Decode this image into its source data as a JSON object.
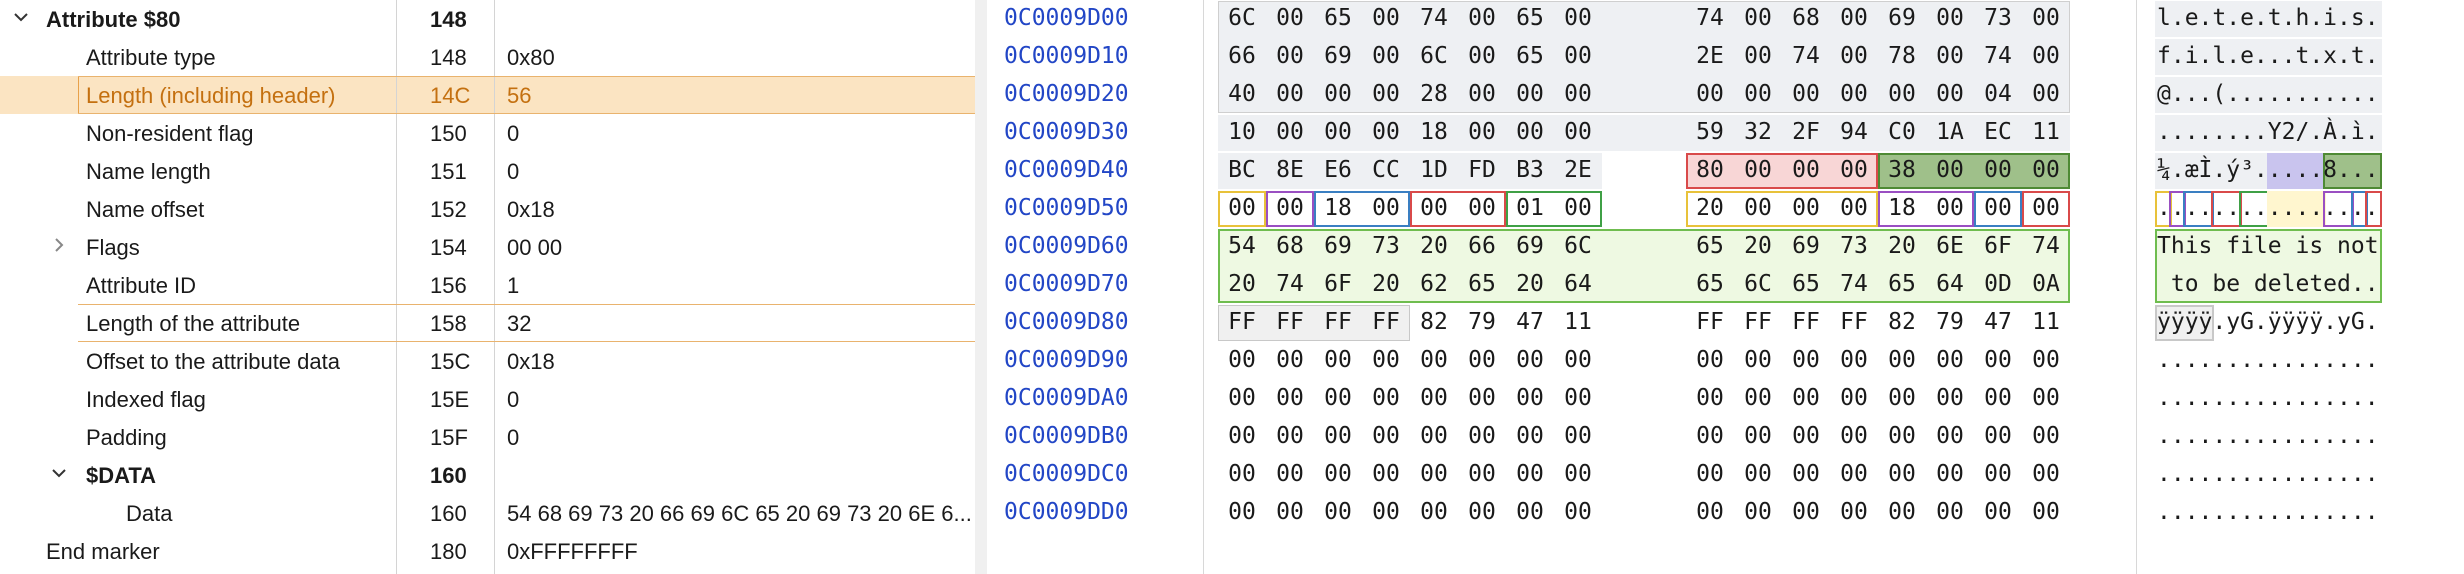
{
  "tree": {
    "rows": [
      {
        "name": "Attribute $80",
        "offset": "148",
        "value": "",
        "level": 0,
        "toggle": "expanded",
        "bold": true
      },
      {
        "name": "Attribute type",
        "offset": "148",
        "value": "0x80",
        "level": 1
      },
      {
        "name": "Length (including header)",
        "offset": "14C",
        "value": "56",
        "level": 1,
        "selected": true
      },
      {
        "name": "Non-resident flag",
        "offset": "150",
        "value": "0",
        "level": 1
      },
      {
        "name": "Name length",
        "offset": "151",
        "value": "0",
        "level": 1
      },
      {
        "name": "Name offset",
        "offset": "152",
        "value": "0x18",
        "level": 1
      },
      {
        "name": "Flags",
        "offset": "154",
        "value": "00 00",
        "level": 1,
        "toggle": "collapsed"
      },
      {
        "name": "Attribute ID",
        "offset": "156",
        "value": "1",
        "level": 1
      },
      {
        "name": "Length of the attribute",
        "offset": "158",
        "value": "32",
        "level": 1
      },
      {
        "name": "Offset to the attribute data",
        "offset": "15C",
        "value": "0x18",
        "level": 1
      },
      {
        "name": "Indexed flag",
        "offset": "15E",
        "value": "0",
        "level": 1
      },
      {
        "name": "Padding",
        "offset": "15F",
        "value": "0",
        "level": 1
      },
      {
        "name": "$DATA",
        "offset": "160",
        "value": "",
        "level": 1,
        "toggle": "expanded",
        "bold": true
      },
      {
        "name": "Data",
        "offset": "160",
        "value": "54 68 69 73 20 66 69 6C 65 20 69 73 20 6E 6...",
        "level": 2
      },
      {
        "name": "End marker",
        "offset": "180",
        "value": "0xFFFFFFFF",
        "level": 0
      }
    ]
  },
  "hex": {
    "rows": [
      {
        "addr": "0C0009D00",
        "bytes": [
          "6C",
          "00",
          "65",
          "00",
          "74",
          "00",
          "65",
          "00",
          "74",
          "00",
          "68",
          "00",
          "69",
          "00",
          "73",
          "00"
        ],
        "ascii": "l.e.t.e.t.h.i.s."
      },
      {
        "addr": "0C0009D10",
        "bytes": [
          "66",
          "00",
          "69",
          "00",
          "6C",
          "00",
          "65",
          "00",
          "2E",
          "00",
          "74",
          "00",
          "78",
          "00",
          "74",
          "00"
        ],
        "ascii": "f.i.l.e...t.x.t."
      },
      {
        "addr": "0C0009D20",
        "bytes": [
          "40",
          "00",
          "00",
          "00",
          "28",
          "00",
          "00",
          "00",
          "00",
          "00",
          "00",
          "00",
          "00",
          "00",
          "04",
          "00"
        ],
        "ascii": "@...(..........."
      },
      {
        "addr": "0C0009D30",
        "bytes": [
          "10",
          "00",
          "00",
          "00",
          "18",
          "00",
          "00",
          "00",
          "59",
          "32",
          "2F",
          "94",
          "C0",
          "1A",
          "EC",
          "11"
        ],
        "ascii": "........Y2/.À.ì."
      },
      {
        "addr": "0C0009D40",
        "bytes": [
          "BC",
          "8E",
          "E6",
          "CC",
          "1D",
          "FD",
          "B3",
          "2E",
          "80",
          "00",
          "00",
          "00",
          "38",
          "00",
          "00",
          "00"
        ],
        "ascii": "¼.æÌ.ý³.....8..."
      },
      {
        "addr": "0C0009D50",
        "bytes": [
          "00",
          "00",
          "18",
          "00",
          "00",
          "00",
          "01",
          "00",
          "20",
          "00",
          "00",
          "00",
          "18",
          "00",
          "00",
          "00"
        ],
        "ascii": "................"
      },
      {
        "addr": "0C0009D60",
        "bytes": [
          "54",
          "68",
          "69",
          "73",
          "20",
          "66",
          "69",
          "6C",
          "65",
          "20",
          "69",
          "73",
          "20",
          "6E",
          "6F",
          "74"
        ],
        "ascii": "This file is not"
      },
      {
        "addr": "0C0009D70",
        "bytes": [
          "20",
          "74",
          "6F",
          "20",
          "62",
          "65",
          "20",
          "64",
          "65",
          "6C",
          "65",
          "74",
          "65",
          "64",
          "0D",
          "0A"
        ],
        "ascii": " to be deleted.."
      },
      {
        "addr": "0C0009D80",
        "bytes": [
          "FF",
          "FF",
          "FF",
          "FF",
          "82",
          "79",
          "47",
          "11",
          "FF",
          "FF",
          "FF",
          "FF",
          "82",
          "79",
          "47",
          "11"
        ],
        "ascii": "ÿÿÿÿ.yG.ÿÿÿÿ.yG."
      },
      {
        "addr": "0C0009D90",
        "bytes": [
          "00",
          "00",
          "00",
          "00",
          "00",
          "00",
          "00",
          "00",
          "00",
          "00",
          "00",
          "00",
          "00",
          "00",
          "00",
          "00"
        ],
        "ascii": "................"
      },
      {
        "addr": "0C0009DA0",
        "bytes": [
          "00",
          "00",
          "00",
          "00",
          "00",
          "00",
          "00",
          "00",
          "00",
          "00",
          "00",
          "00",
          "00",
          "00",
          "00",
          "00"
        ],
        "ascii": "................"
      },
      {
        "addr": "0C0009DB0",
        "bytes": [
          "00",
          "00",
          "00",
          "00",
          "00",
          "00",
          "00",
          "00",
          "00",
          "00",
          "00",
          "00",
          "00",
          "00",
          "00",
          "00"
        ],
        "ascii": "................"
      },
      {
        "addr": "0C0009DC0",
        "bytes": [
          "00",
          "00",
          "00",
          "00",
          "00",
          "00",
          "00",
          "00",
          "00",
          "00",
          "00",
          "00",
          "00",
          "00",
          "00",
          "00"
        ],
        "ascii": "................"
      },
      {
        "addr": "0C0009DD0",
        "bytes": [
          "00",
          "00",
          "00",
          "00",
          "00",
          "00",
          "00",
          "00",
          "00",
          "00",
          "00",
          "00",
          "00",
          "00",
          "00",
          "00"
        ],
        "ascii": "................"
      }
    ],
    "colors": {
      "address": "#2246c6",
      "header_fill": "#eef0f3",
      "attr_type_fill": "#f8d6d6",
      "attr_type_border": "#d94a4a",
      "length_fill": "#9fc08a",
      "length_border": "#4e8a34",
      "data_fill": "#eef9e2",
      "data_border": "#6fbd4f",
      "yellow_border": "#e8c23a",
      "purple_border": "#9a4fc2",
      "blue_border": "#3a7fc2",
      "red_border": "#d94a4a",
      "green_border": "#3fa046"
    }
  }
}
